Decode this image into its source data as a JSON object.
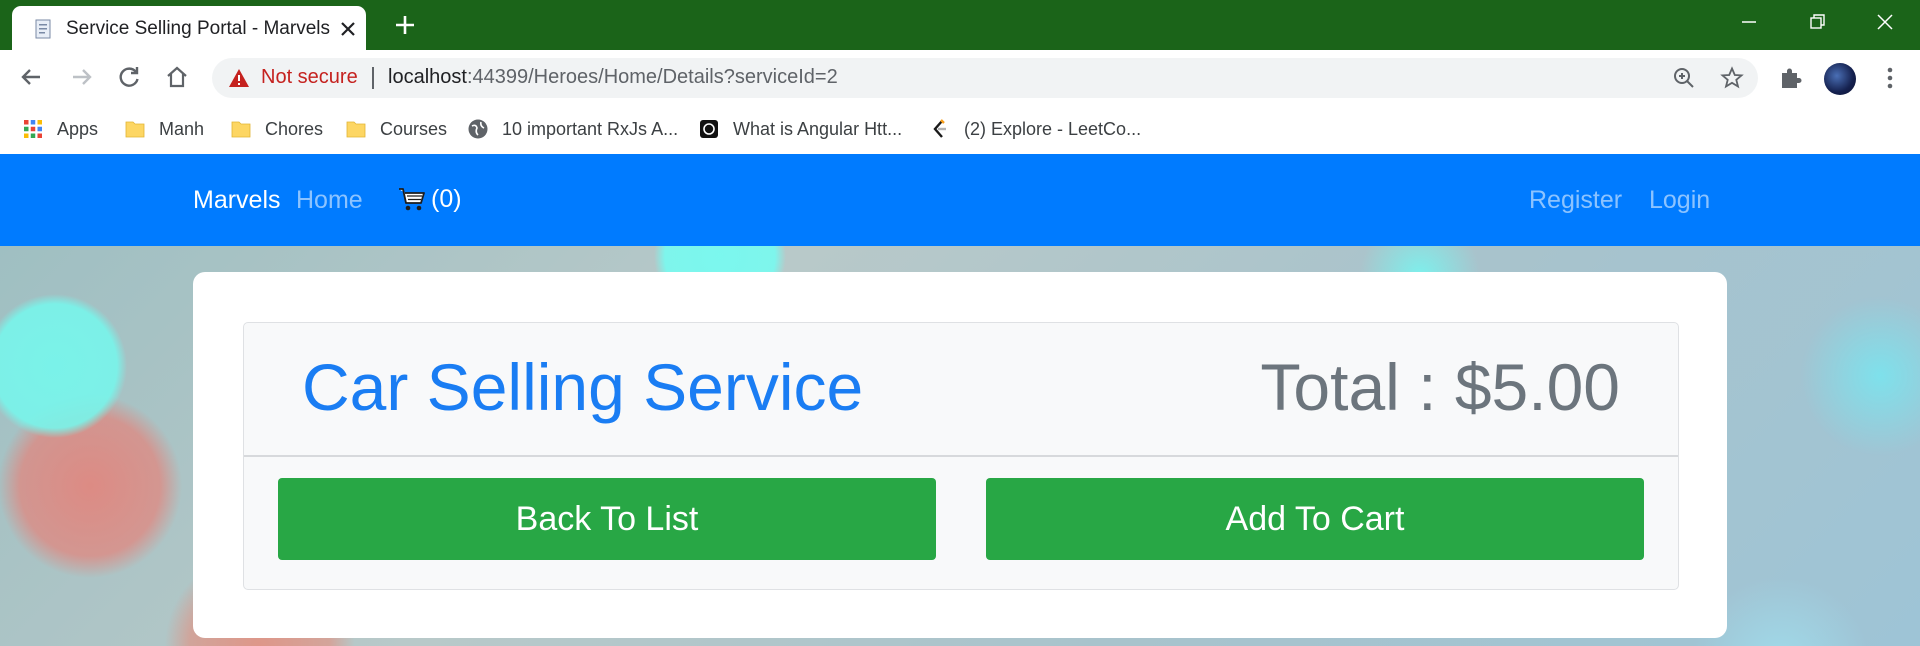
{
  "browser": {
    "tab_title": "Service Selling Portal - Marvels",
    "security_label": "Not secure",
    "url_host": "localhost",
    "url_rest": ":44399/Heroes/Home/Details?serviceId=2",
    "bookmarks": [
      {
        "label": "Apps",
        "icon": "apps-grid-icon"
      },
      {
        "label": "Manh",
        "icon": "folder-icon"
      },
      {
        "label": "Chores",
        "icon": "folder-icon"
      },
      {
        "label": "Courses",
        "icon": "folder-icon"
      },
      {
        "label": "10 important RxJs A...",
        "icon": "globe-icon"
      },
      {
        "label": "What is Angular Htt...",
        "icon": "site-favicon-icon"
      },
      {
        "label": "(2) Explore - LeetCo...",
        "icon": "leetcode-icon"
      }
    ]
  },
  "navbar": {
    "brand": "Marvels",
    "home": "Home",
    "cart_count": "(0)",
    "register": "Register",
    "login": "Login"
  },
  "details": {
    "service_name": "Car Selling Service",
    "total": "Total : $5.00",
    "back_label": "Back To List",
    "add_label": "Add To Cart"
  },
  "colors": {
    "chrome_tabbar": "#1b6419",
    "navbar": "#007bff",
    "service_name": "#1a7df3",
    "total": "#6c757d",
    "button": "#28a745"
  }
}
